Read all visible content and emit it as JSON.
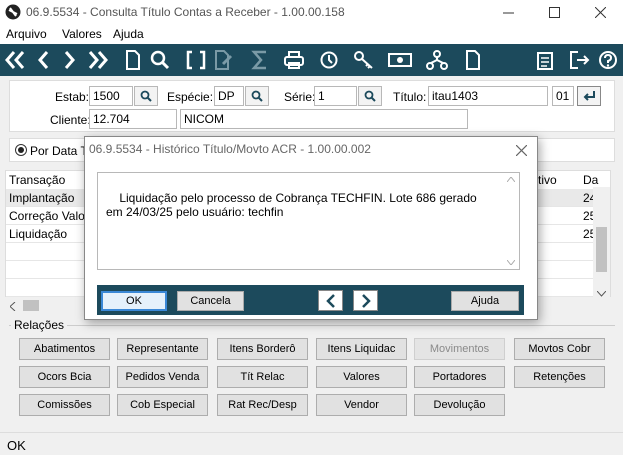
{
  "window": {
    "title": "06.9.5534 - Consulta Título Contas a Receber - 1.00.00.158"
  },
  "menu": [
    "Arquivo",
    "Valores",
    "Ajuda"
  ],
  "filters": {
    "estab_label": "Estab:",
    "estab_value": "1500",
    "especie_label": "Espécie:",
    "especie_value": "DP",
    "serie_label": "Série:",
    "serie_value": "1",
    "titulo_label": "Título:",
    "titulo_value": "itau1403",
    "parcela_value": "01",
    "cliente_label": "Cliente:",
    "cliente_code": "12.704",
    "cliente_name": "NICOM"
  },
  "radio": {
    "label": "Por Data Tr"
  },
  "grid": {
    "headers": [
      "Transação",
      "tivo",
      "Da"
    ],
    "rows": [
      {
        "transacao": "Implantação",
        "data": "24"
      },
      {
        "transacao": "Correção Valo",
        "data": "25"
      },
      {
        "transacao": "Liquidação",
        "data": "25"
      }
    ]
  },
  "relacoes": {
    "title": "Relações",
    "buttons": [
      [
        "Abatimentos",
        "Representante",
        "Itens Borderô",
        "Itens Liquidac",
        "Movimentos",
        "Movtos Cobr"
      ],
      [
        "Ocors Bcia",
        "Pedidos Venda",
        "Tít Relac",
        "Valores",
        "Portadores",
        "Retenções"
      ],
      [
        "Comissões",
        "Cob Especial",
        "Rat Rec/Desp",
        "Vendor",
        "Devolução"
      ]
    ]
  },
  "status": {
    "text": "OK"
  },
  "dialog": {
    "title": "06.9.5534 - Histórico Título/Movto ACR - 1.00.00.002",
    "memo": "Liquidação pelo processo de Cobrança TECHFIN. Lote 686 gerado\nem 24/03/25 pelo usuário: techfin",
    "ok_label": "OK",
    "cancel_label": "Cancela",
    "help_label": "Ajuda"
  },
  "colors": {
    "toolbar": "#1c4a5c",
    "accent": "#3a88d6"
  }
}
